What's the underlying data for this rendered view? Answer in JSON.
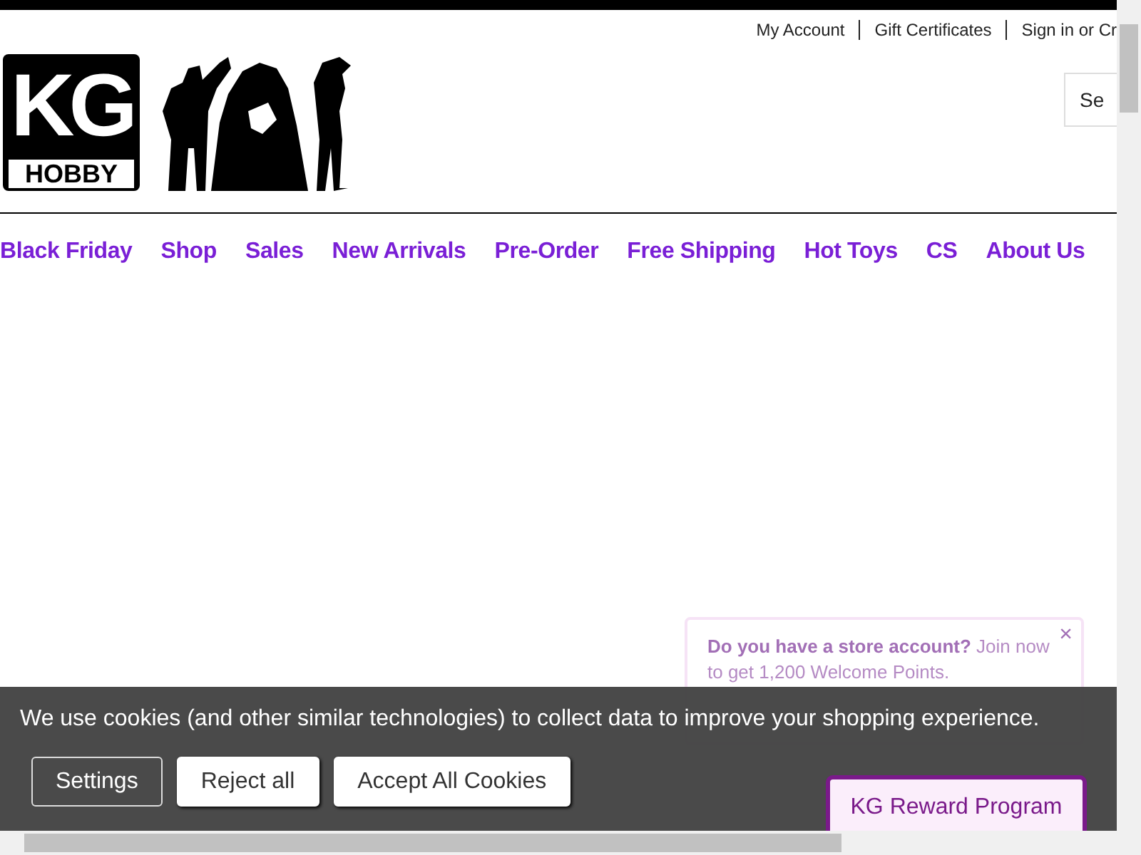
{
  "top_links": [
    "My Account",
    "Gift Certificates",
    "Sign in or Cr"
  ],
  "logo": {
    "mark": "KG",
    "word": "HOBBY"
  },
  "search": {
    "placeholder": "Se"
  },
  "nav": [
    "Black Friday",
    "Shop",
    "Sales",
    "New Arrivals",
    "Pre-Order",
    "Free Shipping",
    "Hot Toys",
    "CS",
    "About Us"
  ],
  "reward_popup": {
    "question": "Do you have a store account?",
    "text": " Join now to get 1,200 Welcome Points.",
    "close": "×"
  },
  "cookie_banner": {
    "message": "We use cookies (and other similar technologies) to collect data to improve your shopping experience.",
    "buttons": [
      {
        "label": "Settings",
        "kind": "outline"
      },
      {
        "label": "Reject all",
        "kind": "solid"
      },
      {
        "label": "Accept All Cookies",
        "kind": "solid"
      }
    ]
  },
  "reward_button": "KG Reward Program"
}
